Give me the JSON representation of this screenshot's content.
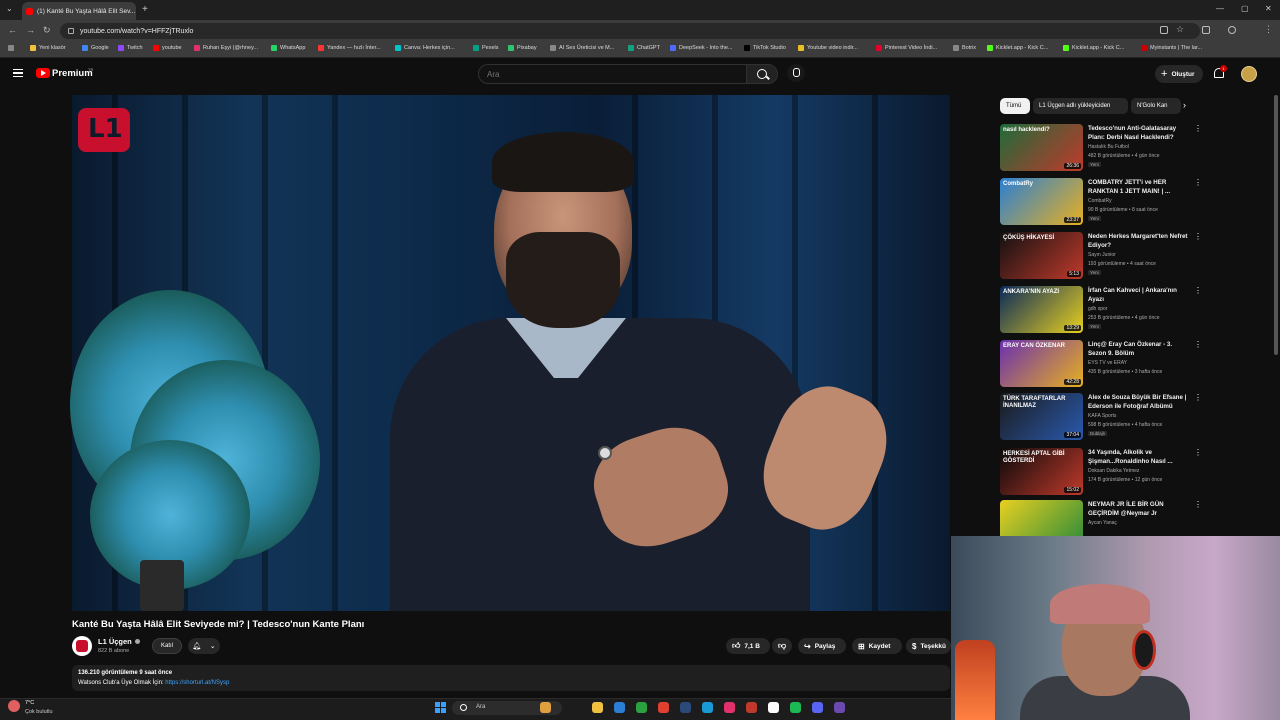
{
  "browser": {
    "tab_title": "(1) Kanté Bu Yaşta Hâlâ Elit Sev...",
    "url": "youtube.com/watch?v=HFFZjTRuxlo",
    "bookmarks": [
      "Yeni klasör",
      "Google",
      "Twitch",
      "youtube",
      "Ruhan Eşyi (@rhney...",
      "WhatsApp",
      "Yandex — hızlı İnter...",
      "Canva: Herkes için...",
      "Pexels",
      "Pixabay",
      "AI Ses Üreticisi ve M...",
      "ChatGPT",
      "DeepSeek - Into the...",
      "TikTok Studio",
      "Youtube video indir...",
      "Pinterest Video İndi...",
      "Botrix",
      "Kicklet.app - Kick C...",
      "Kicklet.app - Kick C...",
      "Myinstants | The lar..."
    ]
  },
  "header": {
    "logo_text": "Premium",
    "logo_sup": "TR",
    "search_placeholder": "Ara",
    "create_label": "Oluştur",
    "notif_count": "1"
  },
  "video": {
    "title": "Kanté Bu Yaşta Hâlâ Elit Seviyede mi? | Tedesco'nun Kante Planı",
    "channel": "L1 Üçgen",
    "subscribers": "822 B abone",
    "join_label": "Katıl",
    "likes": "7,1 B",
    "share_label": "Paylaş",
    "save_label": "Kaydet",
    "thanks_label": "Teşekkü",
    "views_line": "136.210 görüntüleme  9 saat önce",
    "desc_prefix": "Watsons Club'a Üye Olmak İçin: ",
    "desc_link": "https://shorturl.at/NSysp",
    "overlay_logo": "L1"
  },
  "chips": [
    "Tümü",
    "L1 Üçgen adlı yükleyiciden",
    "N'Golo Kan"
  ],
  "recommendations": [
    {
      "title": "Tedesco'nun Anti-Galatasaray Planı: Derbi Nasıl Hacklendi?",
      "channel": "Hastalık Bu Futbol",
      "views": "482 B görüntüleme • 4 gün önce",
      "badge": "Yeni",
      "duration": "26:36",
      "thumb_text": "nasıl hacklendi?",
      "colors": [
        "#1f6b3a",
        "#c0392b"
      ]
    },
    {
      "title": "COMBATRY JETT'i ve HER RANKTAN 1 JETT MAIN! | ...",
      "channel": "CombatRy",
      "views": "90 B görüntüleme • 8 saat önce",
      "badge": "Yeni",
      "duration": "23:37",
      "thumb_text": "CombatRy",
      "colors": [
        "#2a7fd4",
        "#e8b020"
      ]
    },
    {
      "title": "Neden Herkes Margaret'ten Nefret Ediyor?",
      "channel": "Sayın Junior",
      "views": "193 görüntüleme • 4 saat önce",
      "badge": "Yeni",
      "duration": "5:13",
      "thumb_text": "ÇÖKÜŞ HİKAYESİ",
      "colors": [
        "#111111",
        "#c0392b"
      ]
    },
    {
      "title": "İrfan Can Kahveci | Ankara'nın Ayazı",
      "channel": "gdh spor",
      "views": "253 B görüntüleme • 4 gün önce",
      "badge": "Yeni",
      "duration": "13:29",
      "thumb_text": "ANKARA'NIN AYAZI",
      "colors": [
        "#0b2a5a",
        "#e8d020"
      ]
    },
    {
      "title": "Linç@ Eray Can Özkenar - 3. Sezon 9. Bölüm",
      "channel": "EYS TV ve ERAY",
      "views": "435 B görüntüleme • 3 hafta önce",
      "badge": "",
      "duration": "42:28",
      "thumb_text": "ERAY CAN ÖZKENAR",
      "colors": [
        "#6a2fb0",
        "#e8b020"
      ]
    },
    {
      "title": "Alex de Souza Büyük Bir Efsane | Ederson ile Fotoğraf Albümü",
      "channel": "KAFA Sports",
      "views": "598 B görüntüleme • 4 hafta önce",
      "badge": "Dublajlı",
      "duration": "37:04",
      "thumb_text": "TÜRK TARAFTARLAR İNANILMAZ",
      "colors": [
        "#1a1a1a",
        "#2a5ab0"
      ]
    },
    {
      "title": "34 Yaşında, Alkolik ve Şişman...Ronaldinho Nasıl ...",
      "channel": "Doksan Dakika Yetmez",
      "views": "174 B görüntüleme • 12 gün önce",
      "badge": "",
      "duration": "15:02",
      "thumb_text": "HERKESİ APTAL GİBİ GÖSTERDİ",
      "colors": [
        "#0a0a0a",
        "#c0392b"
      ]
    },
    {
      "title": "NEYMAR JR İLE BİR GÜN GEÇİRDİM @Neymar Jr",
      "channel": "Aycan Yanaç",
      "views": "",
      "badge": "",
      "duration": "",
      "thumb_text": "",
      "colors": [
        "#e8d020",
        "#2a8a3a"
      ]
    }
  ],
  "taskbar": {
    "temp": "7°C",
    "weather": "Çok bulutlu",
    "search": "Ara"
  }
}
